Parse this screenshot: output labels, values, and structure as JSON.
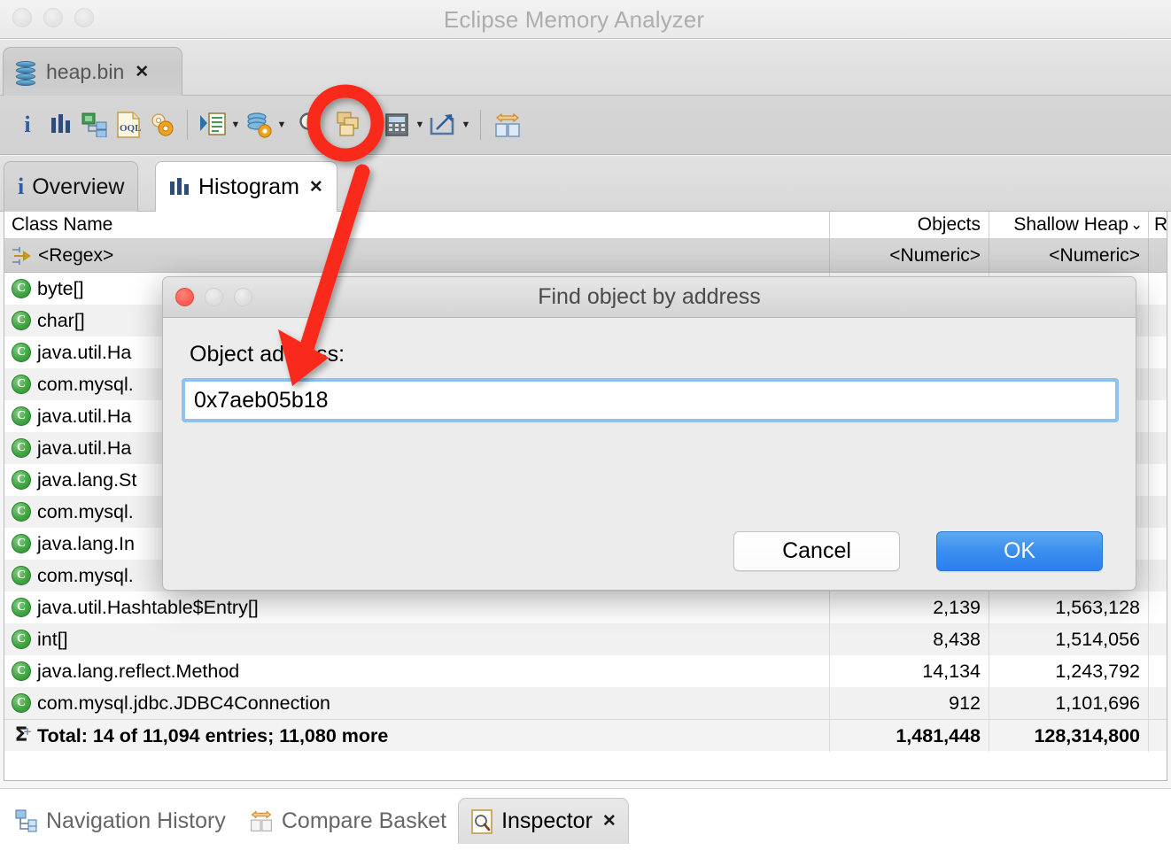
{
  "window": {
    "title": "Eclipse Memory Analyzer",
    "controls": [
      "close",
      "minimize",
      "zoom"
    ]
  },
  "editor_tab": {
    "label": "heap.bin",
    "close_label": "✕",
    "icon": "heap-dump-icon"
  },
  "toolbar": {
    "items": [
      {
        "name": "overview-info-button",
        "icon": "info-icon",
        "caret": false
      },
      {
        "name": "histogram-button",
        "icon": "histogram-icon",
        "caret": false
      },
      {
        "name": "dominator-tree-button",
        "icon": "dominator-tree-icon",
        "caret": false
      },
      {
        "name": "oql-button",
        "icon": "oql-icon",
        "caret": false
      },
      {
        "name": "thread-overview-button",
        "icon": "gears-icon",
        "caret": false
      },
      {
        "name": "run-expert-system-button",
        "icon": "run-query-icon",
        "caret": true
      },
      {
        "name": "heap-dump-actions-button",
        "icon": "heap-config-icon",
        "caret": true
      },
      {
        "name": "find-object-by-address-button",
        "icon": "search-icon",
        "caret": false
      },
      {
        "name": "group-result-button",
        "icon": "group-windows-icon",
        "caret": true
      },
      {
        "name": "calculate-button",
        "icon": "calculator-icon",
        "caret": true
      },
      {
        "name": "export-button",
        "icon": "export-arrow-icon",
        "caret": true
      },
      {
        "name": "compare-button",
        "icon": "compare-icon",
        "caret": false
      }
    ]
  },
  "view_tabs": [
    {
      "label": "Overview",
      "icon": "info-icon",
      "active": false,
      "closable": false
    },
    {
      "label": "Histogram",
      "icon": "histogram-icon",
      "active": true,
      "closable": true,
      "close_label": "✕"
    }
  ],
  "table": {
    "columns": [
      {
        "key": "class_name",
        "label": "Class Name",
        "align": "left",
        "sorted": false
      },
      {
        "key": "objects",
        "label": "Objects",
        "align": "right",
        "sorted": false
      },
      {
        "key": "shallow_heap",
        "label": "Shallow Heap",
        "align": "right",
        "sorted": true,
        "sort_indicator": "⌄"
      },
      {
        "key": "retained_heap",
        "label": "R",
        "align": "right",
        "sorted": false
      }
    ],
    "filter_row": {
      "icon": "regex-filter-icon",
      "class_name": "<Regex>",
      "objects": "<Numeric>",
      "shallow_heap": "<Numeric>",
      "retained_heap": ""
    },
    "rows": [
      {
        "icon": "class-icon",
        "class_name": "byte[]",
        "objects": "",
        "shallow_heap": "",
        "retained_heap": ""
      },
      {
        "icon": "class-icon",
        "class_name": "char[]",
        "objects": "",
        "shallow_heap": "",
        "retained_heap": ""
      },
      {
        "icon": "class-icon",
        "class_name": "java.util.Ha",
        "objects": "",
        "shallow_heap": "",
        "retained_heap": ""
      },
      {
        "icon": "class-icon",
        "class_name": "com.mysql.",
        "objects": "",
        "shallow_heap": "",
        "retained_heap": ""
      },
      {
        "icon": "class-icon",
        "class_name": "java.util.Ha",
        "objects": "",
        "shallow_heap": "",
        "retained_heap": ""
      },
      {
        "icon": "class-icon",
        "class_name": "java.util.Ha",
        "objects": "",
        "shallow_heap": "",
        "retained_heap": ""
      },
      {
        "icon": "class-icon",
        "class_name": "java.lang.St",
        "objects": "",
        "shallow_heap": "",
        "retained_heap": ""
      },
      {
        "icon": "class-icon",
        "class_name": "com.mysql.",
        "objects": "",
        "shallow_heap": "",
        "retained_heap": ""
      },
      {
        "icon": "class-icon",
        "class_name": "java.lang.In",
        "objects": "",
        "shallow_heap": "",
        "retained_heap": ""
      },
      {
        "icon": "class-icon",
        "class_name": "com.mysql.",
        "objects": "",
        "shallow_heap": "",
        "retained_heap": ""
      },
      {
        "icon": "class-icon",
        "class_name": "java.util.Hashtable$Entry[]",
        "objects": "2,139",
        "shallow_heap": "1,563,128",
        "retained_heap": ""
      },
      {
        "icon": "class-icon",
        "class_name": "int[]",
        "objects": "8,438",
        "shallow_heap": "1,514,056",
        "retained_heap": ""
      },
      {
        "icon": "class-icon",
        "class_name": "java.lang.reflect.Method",
        "objects": "14,134",
        "shallow_heap": "1,243,792",
        "retained_heap": ""
      },
      {
        "icon": "class-icon",
        "class_name": "com.mysql.jdbc.JDBC4Connection",
        "objects": "912",
        "shallow_heap": "1,101,696",
        "retained_heap": ""
      }
    ],
    "total_row": {
      "icon": "sum-icon",
      "class_name": "Total: 14 of 11,094 entries; 11,080 more",
      "objects": "1,481,448",
      "shallow_heap": "128,314,800",
      "retained_heap": ""
    }
  },
  "bottom_tabs": [
    {
      "label": "Navigation History",
      "icon": "navigation-history-icon",
      "active": false,
      "closable": false
    },
    {
      "label": "Compare Basket",
      "icon": "compare-basket-icon",
      "active": false,
      "closable": false
    },
    {
      "label": "Inspector",
      "icon": "inspector-icon",
      "active": true,
      "closable": true,
      "close_label": "✕"
    }
  ],
  "dialog": {
    "title": "Find object by address",
    "label": "Object address:",
    "address_value": "0x7aeb05b18",
    "address_placeholder": "",
    "cancel_label": "Cancel",
    "ok_label": "OK"
  },
  "annotation": {
    "highlight_target": "find-object-by-address-button",
    "arrow_points_to": "object-address-input",
    "color": "#f92c1c"
  }
}
